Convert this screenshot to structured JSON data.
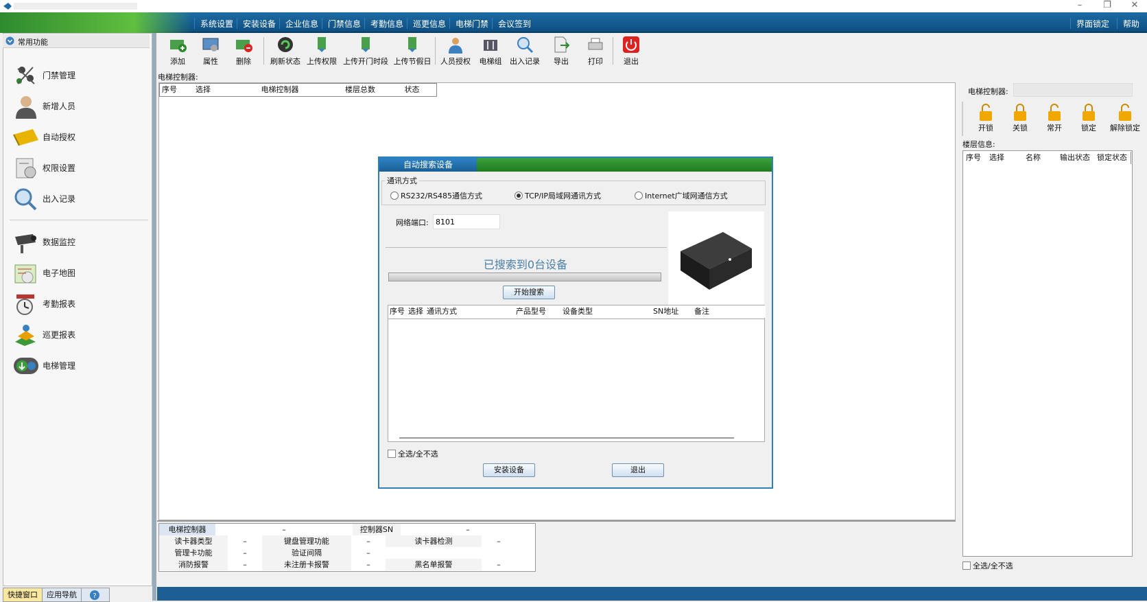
{
  "window": {
    "controls": [
      "–",
      "❐",
      "✕"
    ]
  },
  "menubar": {
    "items": [
      "系统设置",
      "安装设备",
      "企业信息",
      "门禁信息",
      "考勤信息",
      "巡更信息",
      "电梯门禁",
      "会议签到"
    ],
    "right_items": [
      "界面锁定",
      "帮助"
    ]
  },
  "sidebar": {
    "header": "常用功能",
    "group1": [
      {
        "label": "门禁管理",
        "icon": "door-access-icon"
      },
      {
        "label": "新增人员",
        "icon": "person-icon"
      },
      {
        "label": "自动授权",
        "icon": "card-icon"
      },
      {
        "label": "权限设置",
        "icon": "permission-icon"
      },
      {
        "label": "出入记录",
        "icon": "magnifier-icon"
      }
    ],
    "group2": [
      {
        "label": "数据监控",
        "icon": "camera-icon"
      },
      {
        "label": "电子地图",
        "icon": "map-icon"
      },
      {
        "label": "考勤报表",
        "icon": "clock-icon"
      },
      {
        "label": "巡更报表",
        "icon": "patrol-icon"
      },
      {
        "label": "电梯管理",
        "icon": "elevator-icon"
      }
    ],
    "bottom_tabs": [
      "快捷窗口",
      "应用导航",
      "?"
    ]
  },
  "toolbar": {
    "buttons": [
      {
        "label": "添加",
        "icon": "add-icon"
      },
      {
        "label": "属性",
        "icon": "properties-icon"
      },
      {
        "label": "删除",
        "icon": "delete-icon"
      },
      {
        "label": "刷新状态",
        "icon": "refresh-icon"
      },
      {
        "label": "上传权限",
        "icon": "upload-permission-icon"
      },
      {
        "label": "上传开门时段",
        "icon": "upload-timeslot-icon"
      },
      {
        "label": "上传节假日",
        "icon": "upload-holiday-icon"
      },
      {
        "label": "人员授权",
        "icon": "person-auth-icon"
      },
      {
        "label": "电梯组",
        "icon": "elevator-group-icon"
      },
      {
        "label": "出入记录",
        "icon": "records-icon"
      },
      {
        "label": "导出",
        "icon": "export-icon"
      },
      {
        "label": "打印",
        "icon": "print-icon"
      },
      {
        "label": "退出",
        "icon": "power-icon"
      }
    ]
  },
  "main": {
    "section_label": "电梯控制器:",
    "table_headers": [
      "序号",
      "选择",
      "电梯控制器",
      "楼层总数",
      "状态"
    ]
  },
  "right_panel": {
    "controller_label": "电梯控制器:",
    "lock_buttons": [
      "开锁",
      "关锁",
      "常开",
      "锁定",
      "解除锁定"
    ],
    "floor_label": "楼层信息:",
    "floor_headers": [
      "序号",
      "选择",
      "名称",
      "输出状态",
      "锁定状态"
    ],
    "select_all": "全选/全不选"
  },
  "dialog": {
    "tab": "自动搜索设备",
    "comm_group": "通讯方式",
    "radios": [
      {
        "label": "RS232/RS485通信方式",
        "checked": false
      },
      {
        "label": "TCP/IP局域网通讯方式",
        "checked": true
      },
      {
        "label": "Internet广域网通信方式",
        "checked": false
      }
    ],
    "port_label": "网络端口:",
    "port_value": "8101",
    "found_text": "已搜索到0台设备",
    "progress": 0,
    "start_button": "开始搜索",
    "table_headers": [
      "序号",
      "选择",
      "通讯方式",
      "产品型号",
      "设备类型",
      "SN地址",
      "备注"
    ],
    "select_all": "全选/全不选",
    "install_button": "安装设备",
    "exit_button": "退出"
  },
  "info_table": {
    "row1": [
      "电梯控制器",
      "–",
      "控制器SN",
      "–"
    ],
    "rows": [
      [
        "读卡器类型",
        "–",
        "键盘管理功能",
        "–",
        "读卡器检测",
        "–"
      ],
      [
        "管理卡功能",
        "–",
        "验证间隔",
        "–",
        "",
        ""
      ],
      [
        "消防报警",
        "–",
        "未注册卡报警",
        "–",
        "黑名单报警",
        "–"
      ]
    ]
  },
  "colors": {
    "menubar": "#1c6ba5",
    "accent_green": "#2e8a2e",
    "dialog_border": "#2f7fba"
  }
}
